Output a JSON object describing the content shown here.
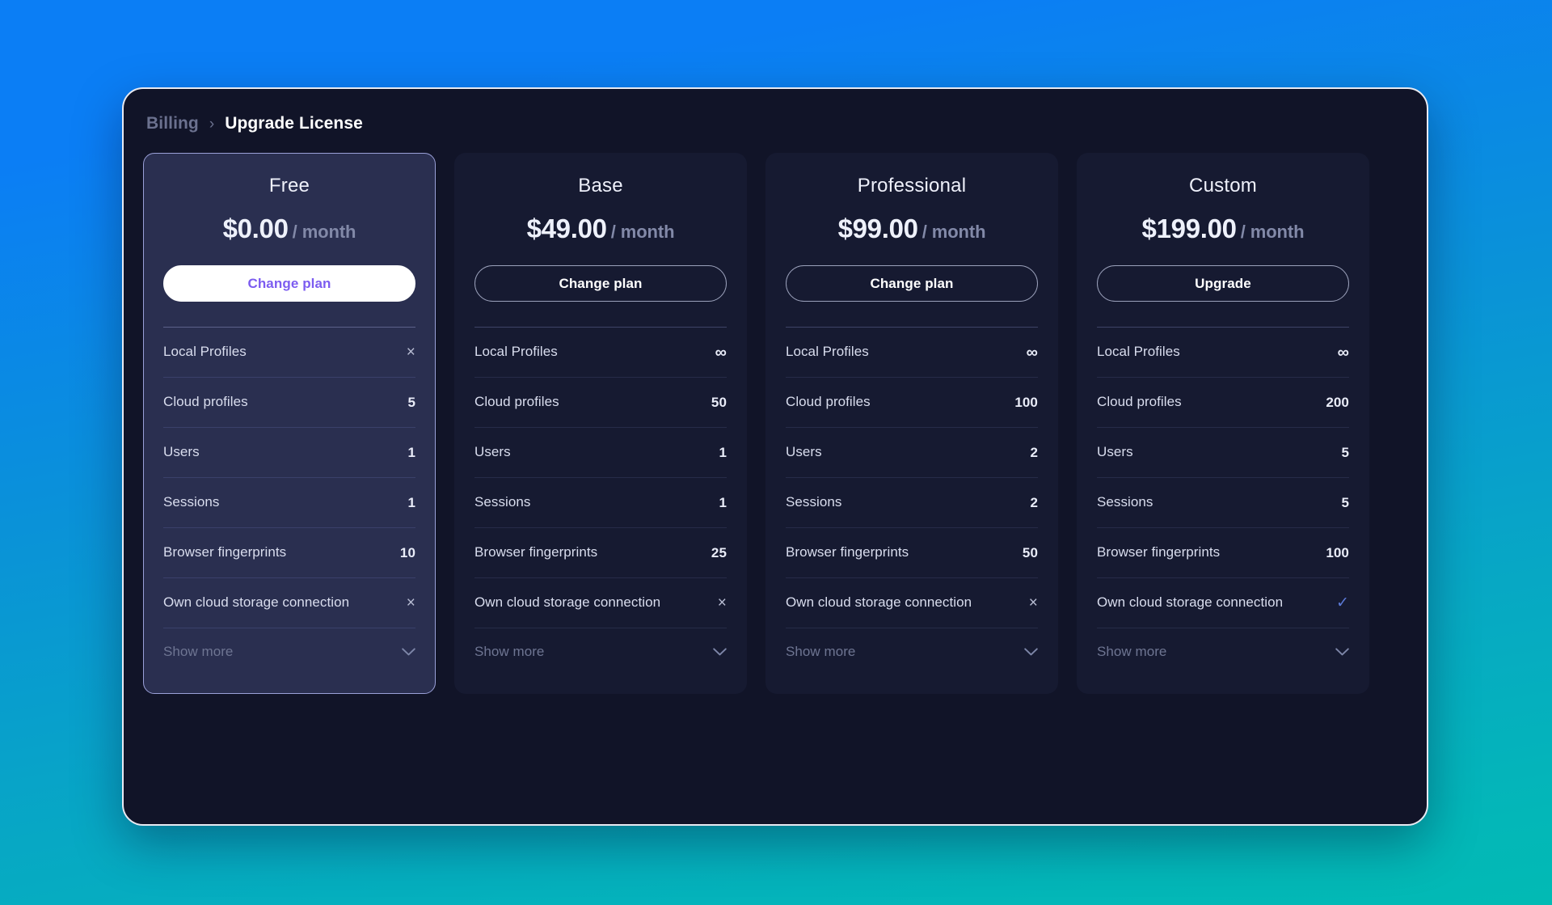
{
  "breadcrumb": {
    "parent": "Billing",
    "separator": "›",
    "current": "Upgrade License"
  },
  "colors": {
    "accent_purple": "#7c5cf0",
    "selected_border": "#9aa0d8",
    "check_blue": "#5b79d6",
    "card_bg": "#161a31",
    "selected_card_bg": "#2a2f50",
    "window_bg": "#111428",
    "gradient_top": "#0b7ef5",
    "gradient_bottom": "#02bab4"
  },
  "show_more_label": "Show more",
  "chevron_icon": "chevron-down-icon",
  "plans": [
    {
      "name": "Free",
      "price": "$0.00",
      "period": "/ month",
      "button_label": "Change plan",
      "button_style": "primary",
      "selected": true,
      "features": [
        {
          "label": "Local Profiles",
          "value": "×",
          "kind": "cross"
        },
        {
          "label": "Cloud profiles",
          "value": "5",
          "kind": "number"
        },
        {
          "label": "Users",
          "value": "1",
          "kind": "number"
        },
        {
          "label": "Sessions",
          "value": "1",
          "kind": "number"
        },
        {
          "label": "Browser fingerprints",
          "value": "10",
          "kind": "number"
        },
        {
          "label": "Own cloud storage connection",
          "value": "×",
          "kind": "cross"
        }
      ]
    },
    {
      "name": "Base",
      "price": "$49.00",
      "period": "/ month",
      "button_label": "Change plan",
      "button_style": "outline",
      "selected": false,
      "features": [
        {
          "label": "Local Profiles",
          "value": "∞",
          "kind": "infinity"
        },
        {
          "label": "Cloud profiles",
          "value": "50",
          "kind": "number"
        },
        {
          "label": "Users",
          "value": "1",
          "kind": "number"
        },
        {
          "label": "Sessions",
          "value": "1",
          "kind": "number"
        },
        {
          "label": "Browser fingerprints",
          "value": "25",
          "kind": "number"
        },
        {
          "label": "Own cloud storage connection",
          "value": "×",
          "kind": "cross"
        }
      ]
    },
    {
      "name": "Professional",
      "price": "$99.00",
      "period": "/ month",
      "button_label": "Change plan",
      "button_style": "outline",
      "selected": false,
      "features": [
        {
          "label": "Local Profiles",
          "value": "∞",
          "kind": "infinity"
        },
        {
          "label": "Cloud profiles",
          "value": "100",
          "kind": "number"
        },
        {
          "label": "Users",
          "value": "2",
          "kind": "number"
        },
        {
          "label": "Sessions",
          "value": "2",
          "kind": "number"
        },
        {
          "label": "Browser fingerprints",
          "value": "50",
          "kind": "number"
        },
        {
          "label": "Own cloud storage connection",
          "value": "×",
          "kind": "cross"
        }
      ]
    },
    {
      "name": "Custom",
      "price": "$199.00",
      "period": "/ month",
      "button_label": "Upgrade",
      "button_style": "outline",
      "selected": false,
      "features": [
        {
          "label": "Local Profiles",
          "value": "∞",
          "kind": "infinity"
        },
        {
          "label": "Cloud profiles",
          "value": "200",
          "kind": "number"
        },
        {
          "label": "Users",
          "value": "5",
          "kind": "number"
        },
        {
          "label": "Sessions",
          "value": "5",
          "kind": "number"
        },
        {
          "label": "Browser fingerprints",
          "value": "100",
          "kind": "number"
        },
        {
          "label": "Own cloud storage connection",
          "value": "✓",
          "kind": "check"
        }
      ]
    }
  ]
}
